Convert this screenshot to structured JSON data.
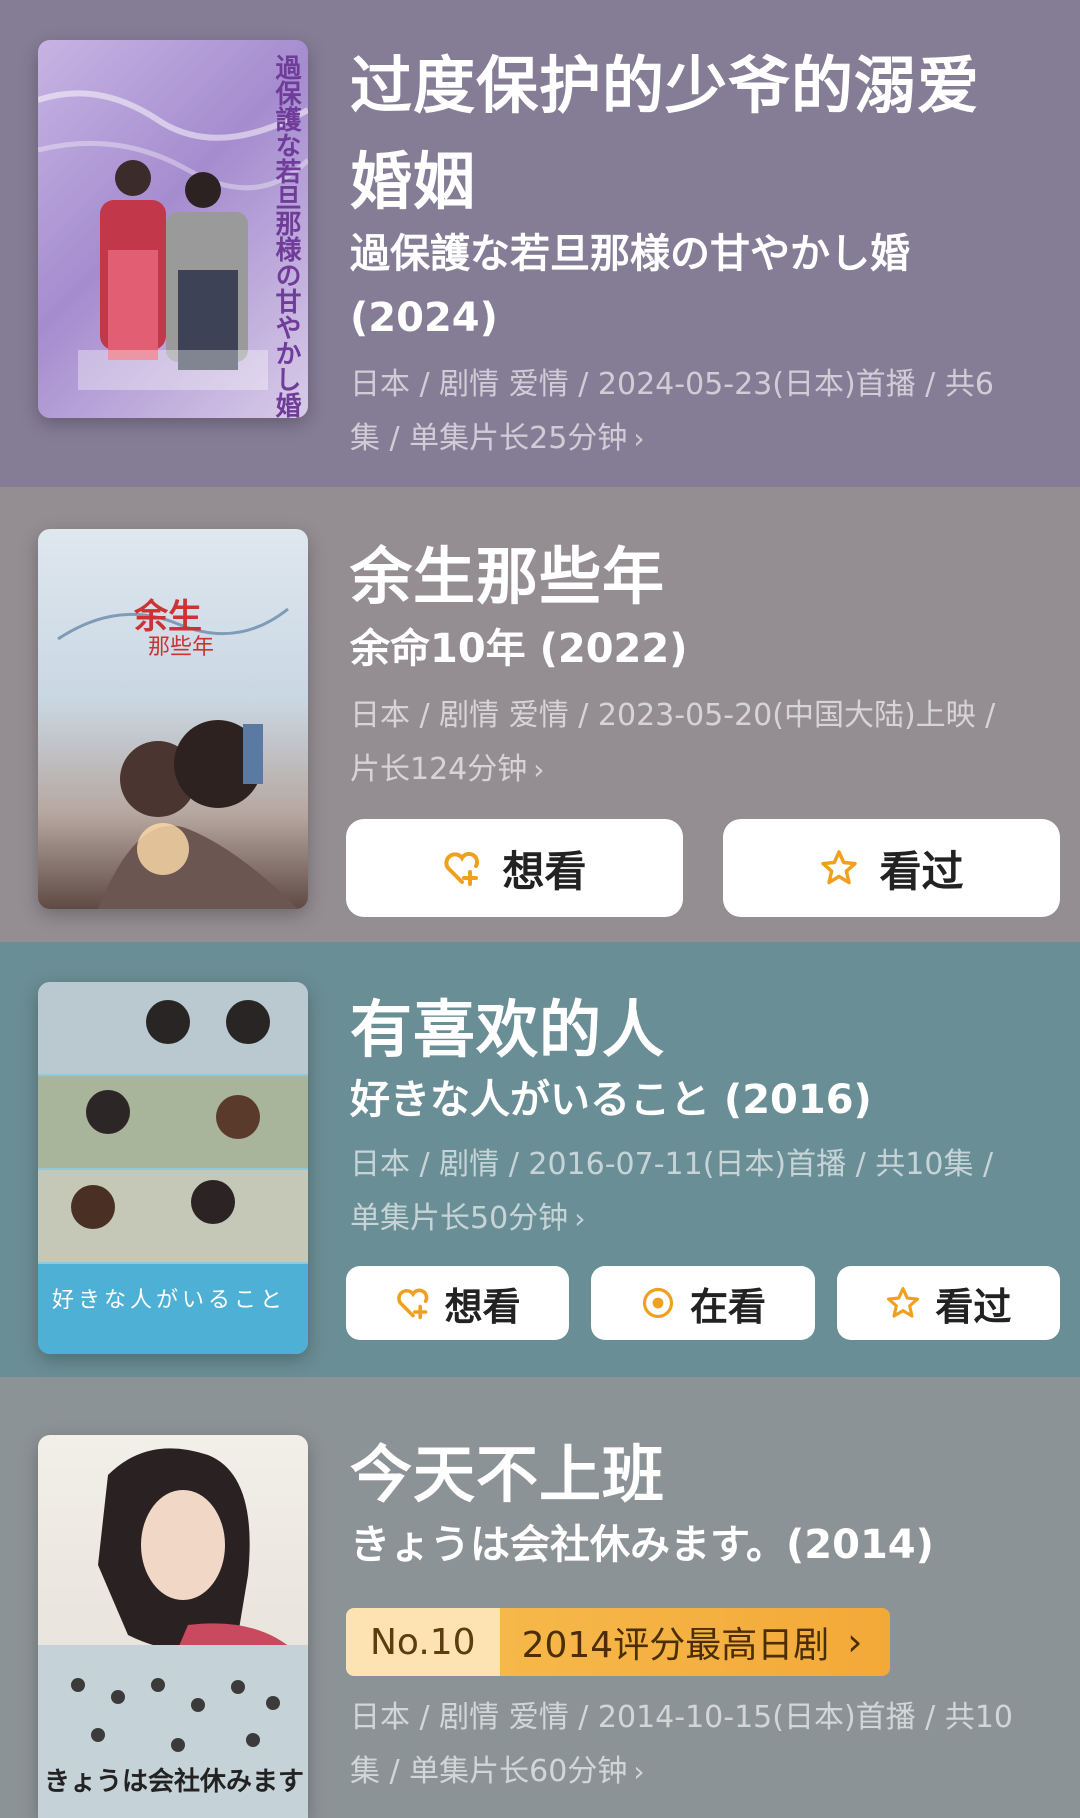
{
  "colors": {
    "card1_bg": "#857d96",
    "card2_bg": "#948e92",
    "card3_bg": "#6a8e95",
    "card4_bg": "#8c9396",
    "accent_orange": "#f0a020"
  },
  "items": [
    {
      "title_cn": "过度保护的少爷的溺爱",
      "title_cn_2": "婚姻",
      "title_orig": "過保護な若旦那様の甘やかし婚",
      "year": "(2024)",
      "meta_1": "日本 / 剧情 爱情 / 2024-05-23(日本)首播 / 共6",
      "meta_2": "集 / 单集片长25分钟",
      "poster_text": "過保護な若旦那様の甘やかし婚"
    },
    {
      "title_cn": "余生那些年",
      "title_orig": "余命10年 (2022)",
      "meta_1": "日本 / 剧情 爱情 / 2023-05-20(中国大陆)上映 /",
      "meta_2": "片长124分钟",
      "poster_text": "余生",
      "poster_text_2": "那些年",
      "buttons": {
        "want": "想看",
        "watched": "看过"
      }
    },
    {
      "title_cn": "有喜欢的人",
      "title_orig": "好きな人がいること (2016)",
      "meta_1": "日本 / 剧情 / 2016-07-11(日本)首播 / 共10集 /",
      "meta_2": "单集片长50分钟",
      "poster_text": "好きな人がいること",
      "buttons": {
        "want": "想看",
        "watching": "在看",
        "watched": "看过"
      }
    },
    {
      "title_cn": "今天不上班",
      "title_orig": "きょうは会社休みます。(2014)",
      "rank_no": "No.10",
      "rank_text": "2014评分最高日剧",
      "meta_1": "日本 / 剧情 爱情 / 2014-10-15(日本)首播 / 共10",
      "meta_2": "集 / 单集片长60分钟",
      "poster_text": "きょうは会社休みます"
    }
  ],
  "chevron": "›"
}
